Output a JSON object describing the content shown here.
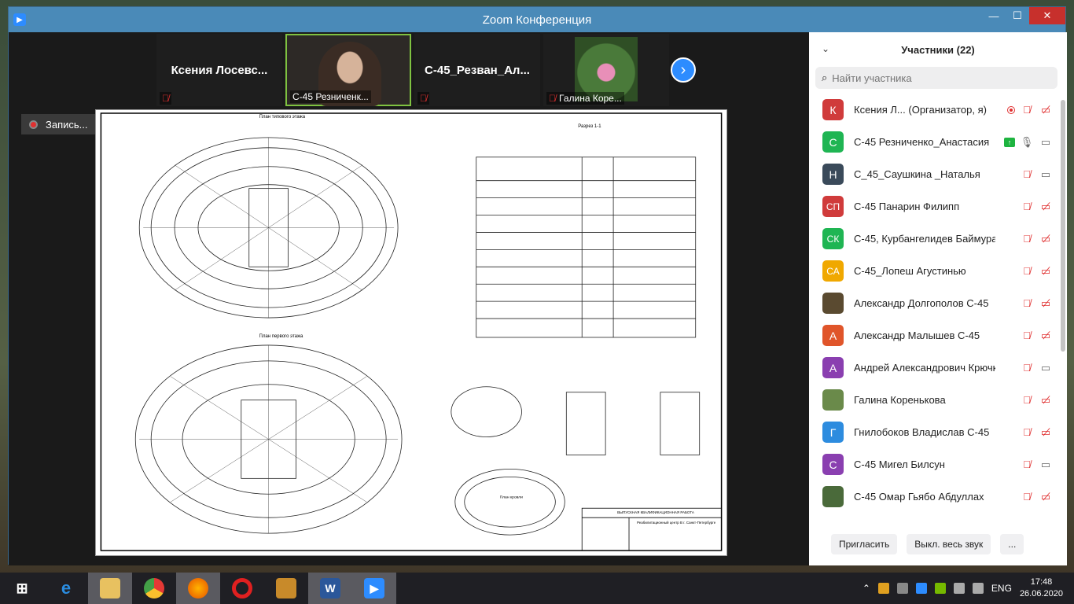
{
  "window": {
    "title": "Zoom Конференция"
  },
  "video_tiles": [
    {
      "name": "Ксения  Лосевс...",
      "muted": true
    },
    {
      "name": "С-45 Резниченк...",
      "muted": false
    },
    {
      "name": "С-45_Резван_Ал...",
      "muted": true
    },
    {
      "name": "Галина Коре...",
      "muted": true
    }
  ],
  "recording": {
    "label": "Запись..."
  },
  "panel": {
    "title": "Участники (22)",
    "search_placeholder": "Найти участника",
    "participants": [
      {
        "initials": "К",
        "name": "Ксения Л...  (Организатор, я)",
        "color": "#d03b3b"
      },
      {
        "initials": "С",
        "name": "С-45 Резниченко_Анастасия",
        "color": "#1fb553"
      },
      {
        "initials": "Н",
        "name": "С_45_Саушкина _Наталья",
        "color": "#3a4a5a"
      },
      {
        "initials": "СП",
        "name": "С-45 Панарин Филипп",
        "color": "#d03b3b"
      },
      {
        "initials": "СК",
        "name": "С-45, Курбангелидев Баймурат",
        "color": "#1fb553"
      },
      {
        "initials": "СА",
        "name": "С-45_Лопеш Агустинью",
        "color": "#f0a800"
      },
      {
        "initials": "",
        "name": "Александр Долгополов С-45",
        "color": "#5a4a30"
      },
      {
        "initials": "А",
        "name": "Александр Малышев С-45",
        "color": "#e0552a"
      },
      {
        "initials": "А",
        "name": "Андрей Александрович Крючк...",
        "color": "#8a3fb0"
      },
      {
        "initials": "",
        "name": "Галина Коренькова",
        "color": "#6a8a4a"
      },
      {
        "initials": "Г",
        "name": "Гнилобоков Владислав С-45",
        "color": "#2d8cdf"
      },
      {
        "initials": "С",
        "name": "С-45 Мигел Билсун",
        "color": "#8a3fb0"
      },
      {
        "initials": "",
        "name": "С-45 Омар Гьябо Абдуллах",
        "color": "#4a6a3a"
      }
    ],
    "invite_label": "Пригласить",
    "mute_all_label": "Выкл. весь звук",
    "more_label": "..."
  },
  "drawing": {
    "plan_typical": "План типового этажа",
    "plan_first": "План первого этажа",
    "section": "Разрез 1-1",
    "roof": "План кровли",
    "thesis": "ВЫПУСКНАЯ КВАЛИФИКАЦИОННАЯ РАБОТА",
    "project": "Реабилитационный центр В г. Санкт-Петербурге"
  },
  "taskbar": {
    "lang": "ENG",
    "time": "17:48",
    "date": "26.06.2020"
  }
}
